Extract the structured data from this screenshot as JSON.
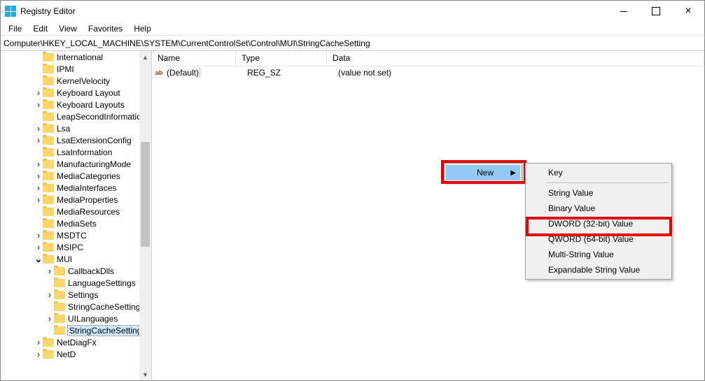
{
  "window": {
    "title": "Registry Editor"
  },
  "menubar": [
    "File",
    "Edit",
    "View",
    "Favorites",
    "Help"
  ],
  "address": "Computer\\HKEY_LOCAL_MACHINE\\SYSTEM\\CurrentControlSet\\Control\\MUI\\StringCacheSetting",
  "tree": [
    {
      "indent": 3,
      "chevron": "",
      "label": "International"
    },
    {
      "indent": 3,
      "chevron": "",
      "label": "IPMI"
    },
    {
      "indent": 3,
      "chevron": "",
      "label": "KernelVelocity"
    },
    {
      "indent": 3,
      "chevron": ">",
      "label": "Keyboard Layout"
    },
    {
      "indent": 3,
      "chevron": ">",
      "label": "Keyboard Layouts"
    },
    {
      "indent": 3,
      "chevron": "",
      "label": "LeapSecondInformation"
    },
    {
      "indent": 3,
      "chevron": ">",
      "label": "Lsa"
    },
    {
      "indent": 3,
      "chevron": ">",
      "label": "LsaExtensionConfig"
    },
    {
      "indent": 3,
      "chevron": "",
      "label": "LsaInformation"
    },
    {
      "indent": 3,
      "chevron": ">",
      "label": "ManufacturingMode"
    },
    {
      "indent": 3,
      "chevron": ">",
      "label": "MediaCategories"
    },
    {
      "indent": 3,
      "chevron": ">",
      "label": "MediaInterfaces"
    },
    {
      "indent": 3,
      "chevron": ">",
      "label": "MediaProperties"
    },
    {
      "indent": 3,
      "chevron": "",
      "label": "MediaResources"
    },
    {
      "indent": 3,
      "chevron": "",
      "label": "MediaSets"
    },
    {
      "indent": 3,
      "chevron": ">",
      "label": "MSDTC"
    },
    {
      "indent": 3,
      "chevron": ">",
      "label": "MSIPC"
    },
    {
      "indent": 3,
      "chevron": "v",
      "label": "MUI"
    },
    {
      "indent": 4,
      "chevron": ">",
      "label": "CallbackDlls"
    },
    {
      "indent": 4,
      "chevron": "",
      "label": "LanguageSettings"
    },
    {
      "indent": 4,
      "chevron": ">",
      "label": "Settings"
    },
    {
      "indent": 4,
      "chevron": "",
      "label": "StringCacheSettings"
    },
    {
      "indent": 4,
      "chevron": ">",
      "label": "UILanguages"
    },
    {
      "indent": 4,
      "chevron": "",
      "label": "StringCacheSetting",
      "selected": true
    },
    {
      "indent": 3,
      "chevron": ">",
      "label": "NetDiagFx"
    },
    {
      "indent": 3,
      "chevron": ">",
      "label": "NetD"
    }
  ],
  "list": {
    "columns": {
      "name": "Name",
      "type": "Type",
      "data": "Data"
    },
    "rows": [
      {
        "icon": "ab",
        "name": "(Default)",
        "type": "REG_SZ",
        "data": "(value not set)"
      }
    ]
  },
  "context_menu": {
    "new_label": "New",
    "submenu": [
      {
        "label": "Key"
      },
      {
        "sep": true
      },
      {
        "label": "String Value"
      },
      {
        "label": "Binary Value"
      },
      {
        "label": "DWORD (32-bit) Value",
        "highlight": true
      },
      {
        "label": "QWORD (64-bit) Value"
      },
      {
        "label": "Multi-String Value"
      },
      {
        "label": "Expandable String Value"
      }
    ]
  }
}
